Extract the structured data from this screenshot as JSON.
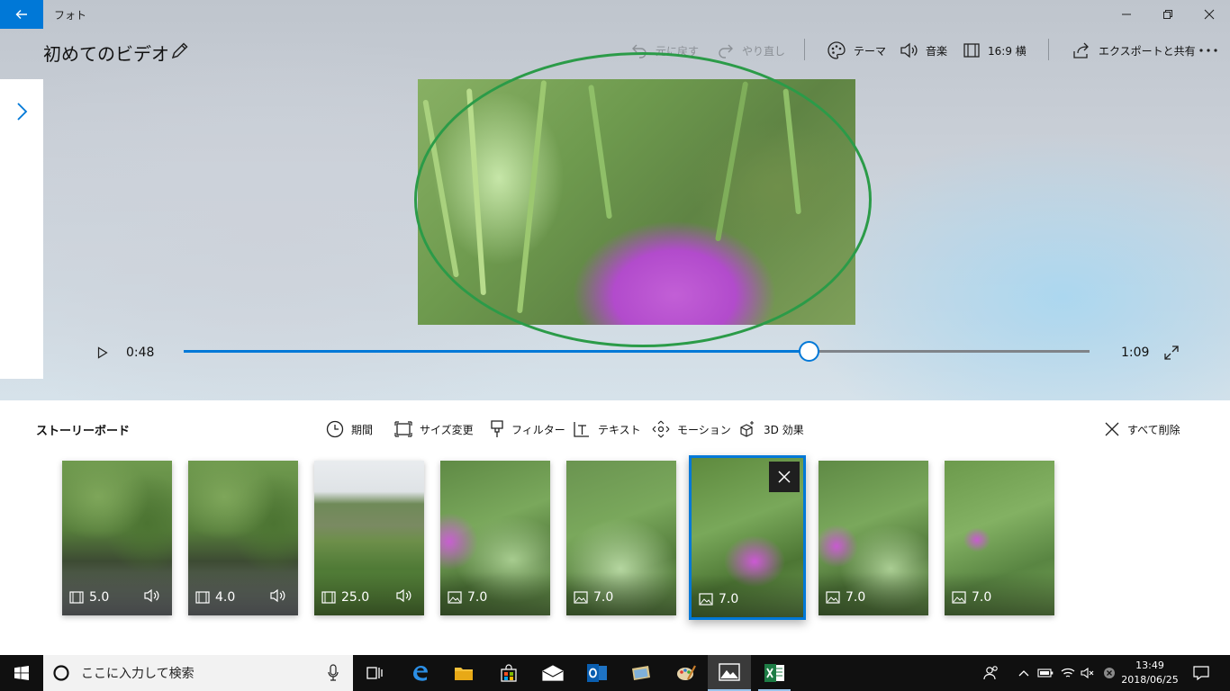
{
  "titlebar": {
    "app_name": "フォト"
  },
  "header": {
    "title": "初めてのビデオ",
    "undo": "元に戻す",
    "redo": "やり直し",
    "theme": "テーマ",
    "music": "音楽",
    "aspect": "16:9 横",
    "export": "エクスポートと共有"
  },
  "player": {
    "current_time": "0:48",
    "total_time": "1:09",
    "progress": 0.69
  },
  "storyboard": {
    "title": "ストーリーボード",
    "tools": {
      "duration": "期間",
      "resize": "サイズ変更",
      "filter": "フィルター",
      "text": "テキスト",
      "motion": "モーション",
      "effects3d": "3D 効果"
    },
    "delete_all": "すべて削除",
    "clips": [
      {
        "type": "video",
        "duration": "5.0",
        "audio": true
      },
      {
        "type": "video",
        "duration": "4.0",
        "audio": true
      },
      {
        "type": "video",
        "duration": "25.0",
        "audio": true
      },
      {
        "type": "image",
        "duration": "7.0",
        "audio": false
      },
      {
        "type": "image",
        "duration": "7.0",
        "audio": false
      },
      {
        "type": "image",
        "duration": "7.0",
        "audio": false,
        "selected": true
      },
      {
        "type": "image",
        "duration": "7.0",
        "audio": false
      },
      {
        "type": "image",
        "duration": "7.0",
        "audio": false
      }
    ]
  },
  "taskbar": {
    "search_placeholder": "ここに入力して検索",
    "time": "13:49",
    "date": "2018/06/25"
  },
  "colors": {
    "accent": "#0078d7",
    "highlight_ellipse": "#2b9b48"
  }
}
